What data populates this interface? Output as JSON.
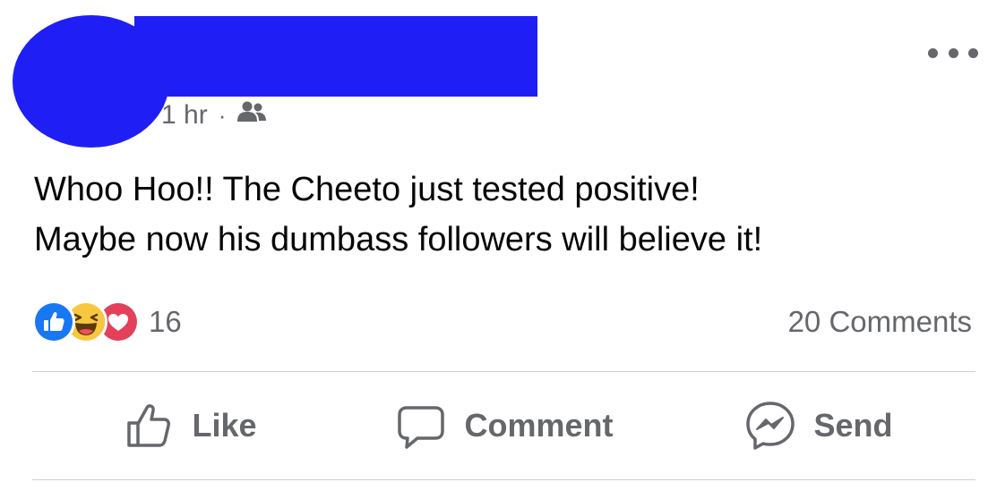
{
  "post": {
    "timestamp": "1 hr",
    "separator": "·",
    "audience_icon": "friends-icon",
    "text_lines": [
      "Whoo Hoo!! The Cheeto just tested positive!",
      "Maybe now his dumbass followers will believe it!"
    ]
  },
  "reactions": {
    "icons": [
      "like-reaction-icon",
      "haha-reaction-icon",
      "love-reaction-icon"
    ],
    "count": "16"
  },
  "comments": {
    "count_label": "20 Comments"
  },
  "actions": {
    "like_label": "Like",
    "comment_label": "Comment",
    "send_label": "Send"
  },
  "colors": {
    "redaction": "#1f1ff5",
    "secondary_text": "#65676b",
    "like_blue": "#1877f2",
    "haha_yellow": "#f7c83f",
    "love_red": "#e4405a",
    "divider": "#ced0d4"
  }
}
